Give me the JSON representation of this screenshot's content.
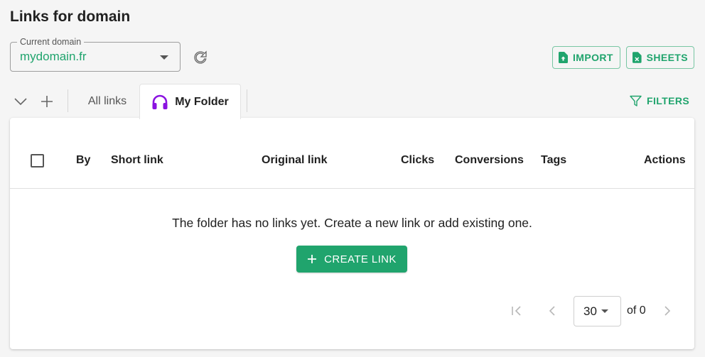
{
  "page": {
    "title": "Links for domain"
  },
  "domain": {
    "legend": "Current domain",
    "value": "mydomain.fr"
  },
  "toolbar": {
    "import_label": "IMPORT",
    "sheets_label": "SHEETS"
  },
  "tabs": {
    "all_links_label": "All links",
    "folder_label": "My Folder",
    "filters_label": "FILTERS"
  },
  "table": {
    "columns": [
      "By",
      "Short link",
      "Original link",
      "Clicks",
      "Conversions",
      "Tags",
      "Actions"
    ],
    "empty_message": "The folder has no links yet. Create a new link or add existing one.",
    "create_label": "CREATE LINK"
  },
  "pagination": {
    "per_page": "30",
    "of_label": "of 0"
  },
  "colors": {
    "accent": "#20a46d",
    "folder_icon": "#8a12e0"
  }
}
